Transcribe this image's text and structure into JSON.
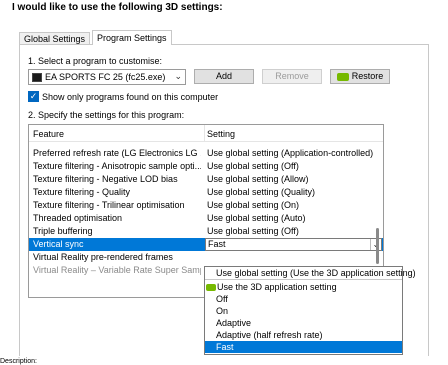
{
  "heading": "I would like to use the following 3D settings:",
  "tabs": [
    {
      "label": "Global Settings"
    },
    {
      "label": "Program Settings"
    }
  ],
  "step1_label": "1. Select a program to customise:",
  "program_select": {
    "value": "EA SPORTS FC 25 (fc25.exe)",
    "icon": "game-icon"
  },
  "buttons": {
    "add": "Add",
    "remove": "Remove",
    "restore": "Restore"
  },
  "show_only_checkbox": {
    "label": "Show only programs found on this computer",
    "checked": true
  },
  "step2_label": "2. Specify the settings for this program:",
  "grid": {
    "headers": {
      "feature": "Feature",
      "setting": "Setting"
    },
    "rows": [
      {
        "feature": "Preferred refresh rate (LG Electronics LG ...",
        "setting": "Use global setting (Application-controlled)"
      },
      {
        "feature": "Texture filtering - Anisotropic sample opti...",
        "setting": "Use global setting (Off)"
      },
      {
        "feature": "Texture filtering - Negative LOD bias",
        "setting": "Use global setting (Allow)"
      },
      {
        "feature": "Texture filtering - Quality",
        "setting": "Use global setting (Quality)"
      },
      {
        "feature": "Texture filtering - Trilinear optimisation",
        "setting": "Use global setting (On)"
      },
      {
        "feature": "Threaded optimisation",
        "setting": "Use global setting (Auto)"
      },
      {
        "feature": "Triple buffering",
        "setting": "Use global setting (Off)"
      },
      {
        "feature": "Vertical sync",
        "setting": "Fast"
      },
      {
        "feature": "Virtual Reality pre-rendered frames",
        "setting": ""
      },
      {
        "feature": "Virtual Reality – Variable Rate Super Samp...",
        "setting": ""
      }
    ]
  },
  "dropdown": {
    "options": [
      "Use global setting (Use the 3D application setting)",
      "Use the 3D application setting",
      "Off",
      "On",
      "Adaptive",
      "Adaptive (half refresh rate)",
      "Fast"
    ],
    "selected": "Fast"
  },
  "description_label": "Description:",
  "colors": {
    "selection": "#0078d7",
    "nvidia_green": "#76b900"
  }
}
